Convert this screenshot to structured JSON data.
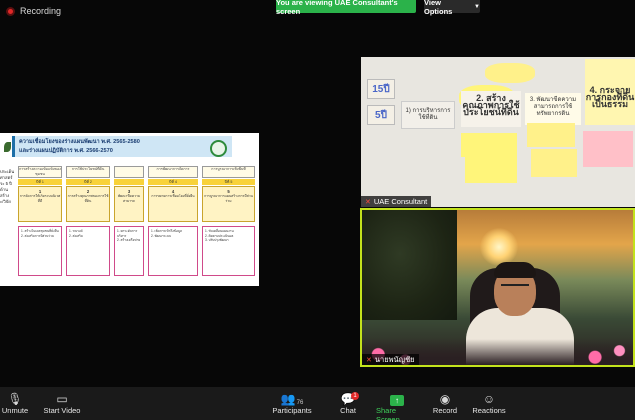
{
  "top": {
    "recording_label": "Recording",
    "banner": "You are viewing UAE Consultant's screen",
    "view_options": "View Options"
  },
  "slide": {
    "title": "ความเชื่อมโยงของร่างแผนพัฒนา พ.ศ. 2565-2580",
    "subtitle": "และร่างแผนปฏิบัติการ พ.ศ. 2566-2570",
    "left_cut": [
      "ประเด็น",
      "ศาสตร์",
      "ระ 5 ปี",
      "",
      "ด้านสร้าง",
      "ะ/วิจัย"
    ],
    "columns": [
      {
        "title": "การสร้างความเข้มแข็งของชุมชน",
        "header": "ปีที่ 1",
        "num": "1",
        "box": "การจัดการให้เกิดระบบนิเวศที่ดี",
        "items": [
          "1. สร้างโมเดลชุมชนที่ยั่งยืน",
          "2. ส่งเสริมการมีส่วนร่วม"
        ]
      },
      {
        "title": "การใช้ประโยชน์ที่ดิน",
        "header": "ปีที่ 2",
        "num": "2",
        "box": "การสร้างคุณภาพของการใช้ที่ดิน",
        "items": [
          "1. รณรงค์",
          "2. ส่งเสริม"
        ]
      },
      {
        "title": "",
        "header": "",
        "num": "3",
        "box": "พัฒนาขีดความสามารถ",
        "items": [
          "1. ยกระดับการบริหาร",
          "2. สร้างเครือข่าย"
        ]
      },
      {
        "title": "การพัฒนาการจัดการ",
        "header": "ปีที่ 4",
        "num": "4",
        "box": "การขยายการเชื่อมโยงที่ยั่งยืน",
        "items": [
          "1. เพิ่มการเข้าถึงข้อมูล",
          "2. พัฒนาระบบ"
        ]
      },
      {
        "title": "การบูรณาการเชิงพื้นที่",
        "header": "ปีที่ 5",
        "num": "5",
        "box": "การบูรณาการแผนสร้างการมีส่วนร่วม",
        "items": [
          "1. ขับเคลื่อนแผนงาน",
          "2. ติดตามประเมินผล",
          "3. ปรับปรุงพัฒนา"
        ]
      }
    ]
  },
  "tiles": [
    {
      "name": "UAE Consultant",
      "muted": true
    },
    {
      "name": "นายพนัญชัย",
      "muted": true
    }
  ],
  "whiteboard": {
    "labels": [
      "15ปี",
      "5ปี",
      "2. สร้างคุณภาพการใช้ประโยชน์ที่ดิน",
      "3. พัฒนาขีดความสามารถการใช้ทรัพยากรดิน",
      "4. กระจายการกองที่ดินเป็นธรรม",
      "1) การบริหารการใช้ที่ดิน"
    ]
  },
  "toolbar": [
    {
      "label": "Unmute",
      "icon": "microphone-muted-icon"
    },
    {
      "label": "Start Video",
      "icon": "camera-off-icon"
    },
    {
      "label": "Participants",
      "icon": "participants-icon",
      "count": "76"
    },
    {
      "label": "Chat",
      "icon": "chat-icon",
      "badge": "1"
    },
    {
      "label": "Share Screen",
      "icon": "share-screen-icon"
    },
    {
      "label": "Record",
      "icon": "record-icon"
    },
    {
      "label": "Reactions",
      "icon": "reactions-icon"
    }
  ]
}
